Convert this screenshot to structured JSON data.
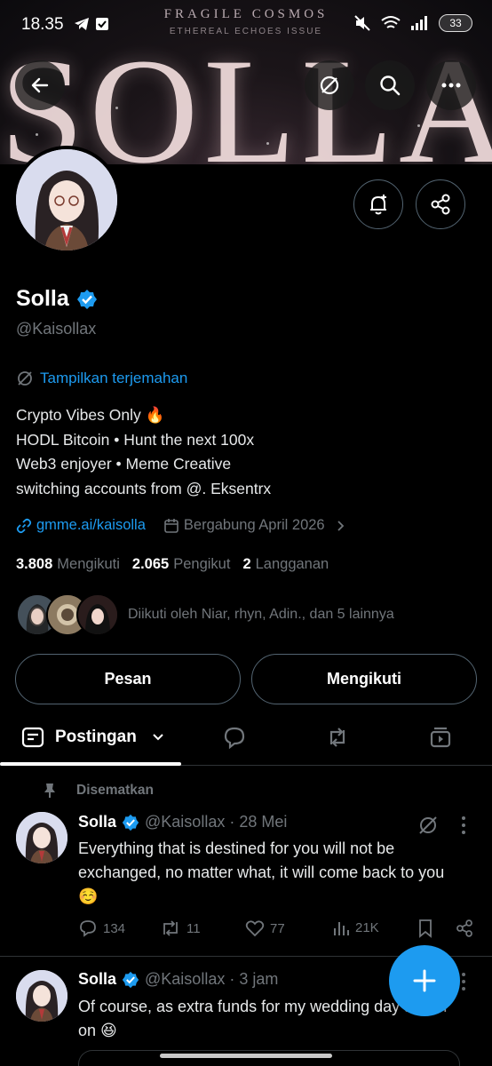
{
  "status_bar": {
    "time": "18.35",
    "battery": "33"
  },
  "banner": {
    "magazine": "FRAGILE COSMOS",
    "issue": "ETHEREAL ECHOES ISSUE",
    "title": "SOLLA"
  },
  "profile": {
    "name": "Solla",
    "handle": "@Kaisollax",
    "translate_label": "Tampilkan terjemahan",
    "bio": [
      "Crypto Vibes Only 🔥",
      "HODL Bitcoin • Hunt the next 100x",
      "Web3 enjoyer • Meme Creative",
      "switching accounts from @. Eksentrx"
    ],
    "link": "gmme.ai/kaisolla",
    "joined": "Bergabung April 2026",
    "stats": {
      "following_count": "3.808",
      "following_label": "Mengikuti",
      "followers_count": "2.065",
      "followers_label": "Pengikut",
      "subs_count": "2",
      "subs_label": "Langganan"
    },
    "followed_by": "Diikuti oleh Niar, rhyn, Adin., dan 5 lainnya"
  },
  "buttons": {
    "message": "Pesan",
    "following": "Mengikuti"
  },
  "tabs": {
    "posts_label": "Postingan"
  },
  "pinned_label": "Disematkan",
  "posts": [
    {
      "name": "Solla",
      "meta": "@Kaisollax · 28 Mei",
      "text": "Everything that is destined for you will not be exchanged, no matter what, it will come back to you ☺️",
      "replies": "134",
      "reposts": "11",
      "likes": "77",
      "views": "21K"
    },
    {
      "name": "Solla",
      "meta": "@Kaisollax · 3 jam",
      "text": "Of course, as extra funds for my wedding day a later on 😆"
    }
  ],
  "colors": {
    "accent": "#1d9bf0",
    "background": "#000000",
    "muted": "#71767b",
    "border": "#2f3336"
  },
  "icons": [
    "telegram-icon",
    "checkbox-icon",
    "mute-icon",
    "wifi-icon",
    "signal-icon",
    "battery-icon",
    "back-arrow-icon",
    "no-translate-icon",
    "search-icon",
    "more-icon",
    "notification-add-icon",
    "share-icon",
    "verified-badge-icon",
    "translate-icon",
    "link-icon",
    "calendar-icon",
    "chevron-right-icon",
    "posts-icon",
    "chevron-down-icon",
    "replies-icon",
    "repost-icon",
    "media-icon",
    "pin-icon",
    "like-icon",
    "views-icon",
    "bookmark-icon",
    "plus-icon"
  ]
}
